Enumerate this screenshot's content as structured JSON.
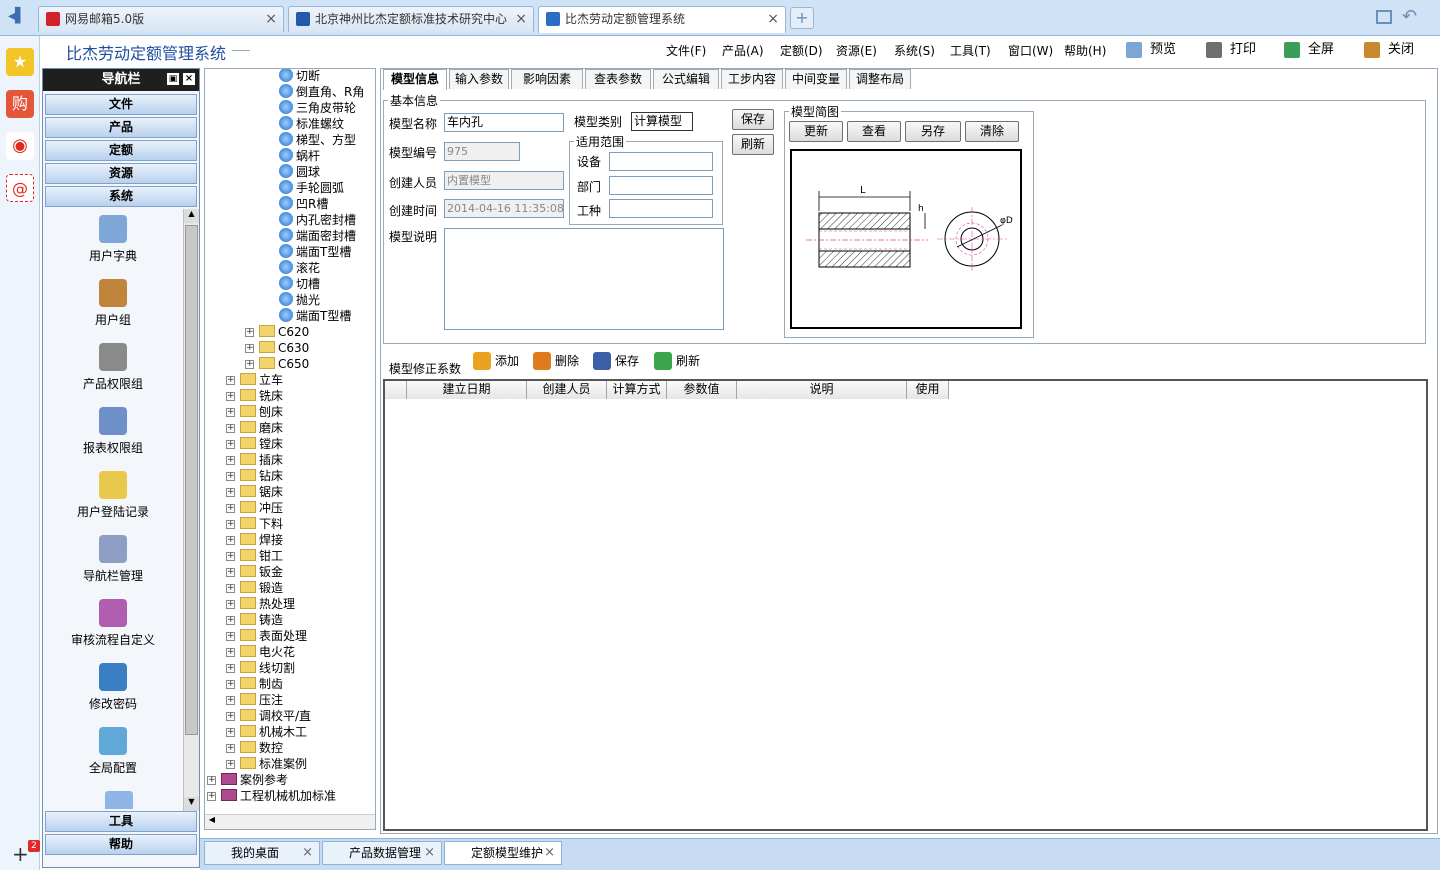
{
  "browser": {
    "tabs": [
      {
        "label": "网易邮箱5.0版",
        "color": "#d2232a"
      },
      {
        "label": "北京神州比杰定额标准技术研究中心",
        "color": "#2458a8"
      },
      {
        "label": "比杰劳动定额管理系统",
        "color": "#2b6cc4"
      }
    ],
    "new_tab": "+",
    "close": "×"
  },
  "app": {
    "title": "比杰劳动定额管理系统",
    "menus": [
      "文件(F)",
      "产品(A)",
      "定额(D)",
      "资源(E)",
      "系统(S)",
      "工具(T)",
      "窗口(W)",
      "帮助(H)"
    ],
    "tools": [
      {
        "label": "预览",
        "icon": "preview-icon",
        "color": "#7da6d6"
      },
      {
        "label": "打印",
        "icon": "print-icon",
        "color": "#6f6f6f"
      },
      {
        "label": "全屏",
        "icon": "fullscreen-icon",
        "color": "#3c9c5a"
      },
      {
        "label": "关闭",
        "icon": "close-door-icon",
        "color": "#c98a2f"
      }
    ]
  },
  "nav": {
    "header": "导航栏",
    "sections_top": [
      "文件",
      "产品",
      "定额",
      "资源",
      "系统"
    ],
    "items": [
      {
        "label": "用户字典",
        "icon": "user-dictionary-icon",
        "color": "#7ea7d8"
      },
      {
        "label": "用户组",
        "icon": "user-group-icon",
        "color": "#c0843a"
      },
      {
        "label": "产品权限组",
        "icon": "product-permission-icon",
        "color": "#8a8a8a"
      },
      {
        "label": "报表权限组",
        "icon": "report-permission-icon",
        "color": "#6f8fc9"
      },
      {
        "label": "用户登陆记录",
        "icon": "login-record-icon",
        "color": "#e9c94b"
      },
      {
        "label": "导航栏管理",
        "icon": "navbar-manage-icon",
        "color": "#8e9fc5"
      },
      {
        "label": "审核流程自定义",
        "icon": "workflow-icon",
        "color": "#b05fb0"
      },
      {
        "label": "修改密码",
        "icon": "password-icon",
        "color": "#3a7fc4"
      },
      {
        "label": "全局配置",
        "icon": "global-config-icon",
        "color": "#5fa8d8"
      }
    ],
    "sections_bottom": [
      "工具",
      "帮助"
    ]
  },
  "tree": {
    "leaves": [
      "切断",
      "倒直角、R角",
      "三角皮带轮",
      "标准螺纹",
      "梯型、方型",
      "蜗杆",
      "圆球",
      "手轮圆弧",
      "凹R槽",
      "内孔密封槽",
      "端面密封槽",
      "端面T型槽",
      "滚花",
      "切槽",
      "抛光",
      "端面T型槽"
    ],
    "machines": [
      "C620",
      "C630",
      "C650"
    ],
    "categories": [
      "立车",
      "铣床",
      "刨床",
      "磨床",
      "镗床",
      "插床",
      "钻床",
      "锯床",
      "冲压",
      "下料",
      "焊接",
      "钳工",
      "钣金",
      "锻造",
      "热处理",
      "铸造",
      "表面处理",
      "电火花",
      "线切割",
      "制齿",
      "压注",
      "调校平/直",
      "机械木工",
      "数控",
      "标准案例"
    ],
    "roots": [
      "案例参考",
      "工程机械机加标准"
    ]
  },
  "content": {
    "tabs": [
      "模型信息",
      "输入参数",
      "影响因素",
      "查表参数",
      "公式编辑",
      "工步内容",
      "中间变量",
      "调整布局"
    ],
    "basic_info": {
      "legend": "基本信息",
      "model_name_label": "模型名称",
      "model_name": "车内孔",
      "model_type_label": "模型类别",
      "model_type": "计算模型",
      "model_no_label": "模型编号",
      "model_no": "975",
      "creator_label": "创建人员",
      "creator": "内置模型",
      "created_label": "创建时间",
      "created": "2014-04-16 11:35:08",
      "desc_label": "模型说明",
      "scope_legend": "适用范围",
      "equipment_label": "设备",
      "dept_label": "部门",
      "worktype_label": "工种",
      "save": "保存",
      "refresh": "刷新"
    },
    "sketch": {
      "legend": "模型简图",
      "buttons": [
        "更新",
        "查看",
        "另存",
        "清除"
      ],
      "labels": [
        "L",
        "h",
        "φD"
      ]
    },
    "coef": {
      "label": "模型修正系数",
      "actions": [
        {
          "label": "添加",
          "icon": "add-icon",
          "color": "#e9a320"
        },
        {
          "label": "删除",
          "icon": "delete-icon",
          "color": "#e07a1f"
        },
        {
          "label": "保存",
          "icon": "save-icon",
          "color": "#3b5fa8"
        },
        {
          "label": "刷新",
          "icon": "refresh-icon",
          "color": "#3aa54a"
        }
      ],
      "columns": [
        "",
        "建立日期",
        "创建人员",
        "计算方式",
        "参数值",
        "说明",
        "使用"
      ]
    }
  },
  "bottom_tabs": [
    "我的桌面",
    "产品数据管理",
    "定额模型维护"
  ],
  "strip": {
    "badge": "2"
  }
}
